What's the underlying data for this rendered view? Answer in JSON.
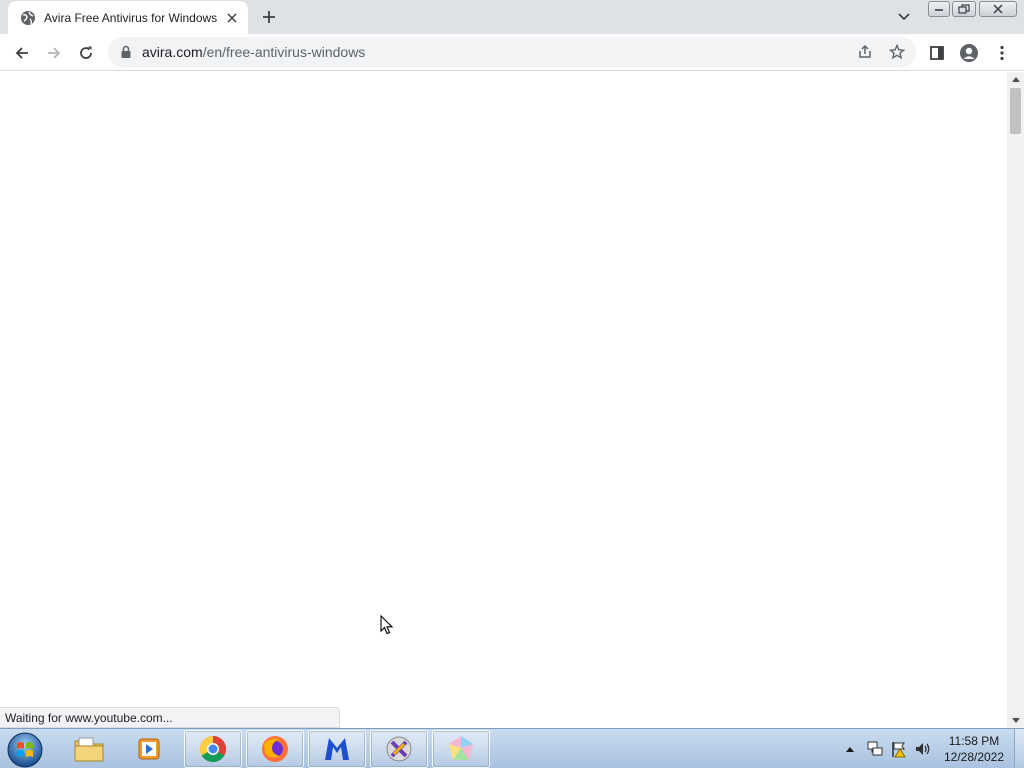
{
  "browser": {
    "tab": {
      "title": "Avira Free Antivirus for Windows",
      "favicon": "globe-icon"
    },
    "omnibox": {
      "url_host": "avira.com",
      "url_path": "/en/free-antivirus-windows"
    },
    "status_text": "Waiting for www.youtube.com...",
    "icons": {
      "back": "arrow-left-icon",
      "forward": "arrow-right-icon",
      "reload": "reload-icon",
      "lock": "lock-icon",
      "share": "share-icon",
      "bookmark": "star-icon",
      "side_panel": "side-panel-icon",
      "profile": "profile-icon",
      "menu": "kebab-menu-icon"
    }
  },
  "taskbar": {
    "pinned": [
      {
        "name": "Windows Explorer",
        "icon": "folder-icon"
      },
      {
        "name": "Windows Media Player",
        "icon": "media-player-icon"
      },
      {
        "name": "Google Chrome",
        "icon": "chrome-icon"
      },
      {
        "name": "Firefox",
        "icon": "firefox-icon"
      },
      {
        "name": "Malwarebytes",
        "icon": "malwarebytes-icon"
      },
      {
        "name": "App",
        "icon": "xfire-icon"
      },
      {
        "name": "App",
        "icon": "gem-app-icon"
      }
    ],
    "clock": {
      "time": "11:58 PM",
      "date": "12/28/2022"
    }
  },
  "colors": {
    "tabstrip_bg": "#dee1e6",
    "omnibox_bg": "#f1f3f4",
    "taskbar_top": "#c9dbef",
    "taskbar_bottom": "#a9c2df"
  }
}
